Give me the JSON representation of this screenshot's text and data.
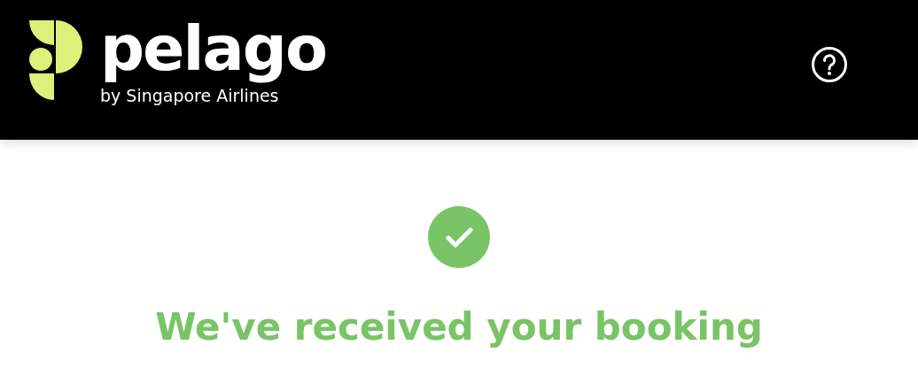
{
  "header": {
    "brand": "pelago",
    "tagline": "by Singapore Airlines"
  },
  "confirmation": {
    "heading": "We've received your booking"
  }
}
